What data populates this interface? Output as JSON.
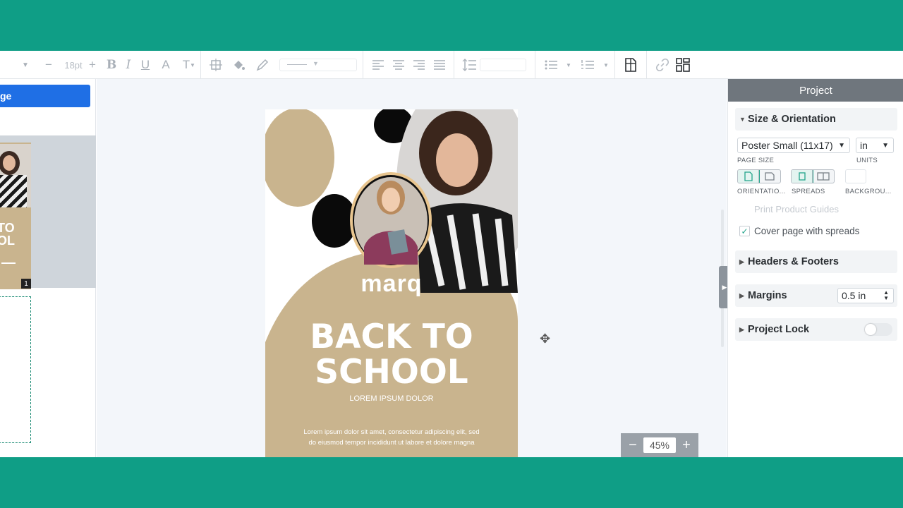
{
  "toolbar": {
    "font_size": "18pt",
    "bold": "B",
    "italic": "I",
    "underline": "U",
    "text_color": "A",
    "text_transform": "T"
  },
  "left_panel": {
    "add_page_label": "ge",
    "thumb_line1": "TO",
    "thumb_line2": "OL",
    "page_number": "1"
  },
  "canvas": {
    "poster": {
      "logo": "marq",
      "title_line1": "BACK TO",
      "title_line2": "SCHOOL",
      "subtitle": "LOREM IPSUM DOLOR",
      "body_line1": "Lorem ipsum dolor sit amet, consectetur adipiscing elit, sed",
      "body_line2": "do eiusmod tempor incididunt ut labore et dolore magna",
      "colors": {
        "tan": "#c9b48e",
        "black": "#0a0a0a"
      }
    },
    "zoom": {
      "minus": "−",
      "value": "45%",
      "plus": "+"
    }
  },
  "right_panel": {
    "title": "Project",
    "size_orientation": {
      "heading": "Size & Orientation",
      "page_size_value": "Poster Small (11x17)",
      "page_size_label": "PAGE SIZE",
      "units_value": "in",
      "units_label": "UNITS",
      "orientation_label": "ORIENTATIO...",
      "spreads_label": "SPREADS",
      "background_label": "BACKGROU...",
      "print_guides": "Print Product Guides",
      "cover_spreads": "Cover page with spreads"
    },
    "headers_footers": "Headers & Footers",
    "margins": {
      "label": "Margins",
      "value": "0.5 in"
    },
    "project_lock": "Project Lock"
  },
  "colors": {
    "teal_bg": "#0f9e86",
    "primary_blue": "#1f6fe5",
    "accent_teal": "#22a48b"
  }
}
